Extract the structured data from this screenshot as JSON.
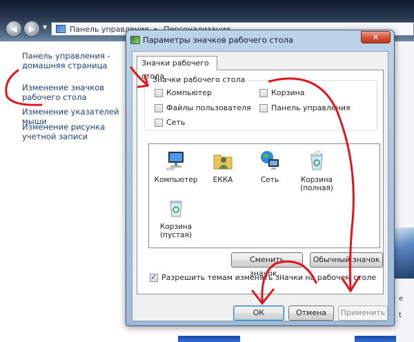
{
  "control_panel": {
    "address_items": [
      "Панель управления",
      "Персонализация"
    ],
    "sidebar_links": [
      "Панель управления - домашняя страница",
      "Изменение значков рабочего стола",
      "Изменение указателей мыши",
      "Изменение рисунка учетной записи"
    ],
    "side_glyphs": [
      "e",
      "t"
    ]
  },
  "dialog": {
    "title": "Параметры значков рабочего стола",
    "close_glyph": "✕",
    "tab_label": "Значки рабочего стола",
    "group_label": "Значки рабочего стола",
    "checkboxes": [
      {
        "label": "Компьютер",
        "checked": false
      },
      {
        "label": "Корзина",
        "checked": false
      },
      {
        "label": "Файлы пользователя",
        "checked": false
      },
      {
        "label": "Панель управления",
        "checked": false
      },
      {
        "label": "Сеть",
        "checked": false
      }
    ],
    "icons": [
      {
        "label": "Компьютер",
        "icon": "computer-icon"
      },
      {
        "label": "ЕККА",
        "icon": "user-folder-icon"
      },
      {
        "label": "Сеть",
        "icon": "network-icon"
      },
      {
        "label": "Корзина (полная)",
        "icon": "recycle-bin-full-icon"
      },
      {
        "label": "Корзина (пустая)",
        "icon": "recycle-bin-empty-icon"
      }
    ],
    "change_icon_label": "Сменить значок...",
    "default_icon_label": "Обычный значок",
    "allow_themes_label": "Разрешить темам изменять значки на рабочем столе",
    "allow_themes_checked": true,
    "ok_label": "ОК",
    "cancel_label": "Отмена",
    "apply_label": "Применить"
  },
  "colors": {
    "annotation": "#e0141a",
    "link": "#1a3f7a",
    "close_button": "#c8422a"
  }
}
